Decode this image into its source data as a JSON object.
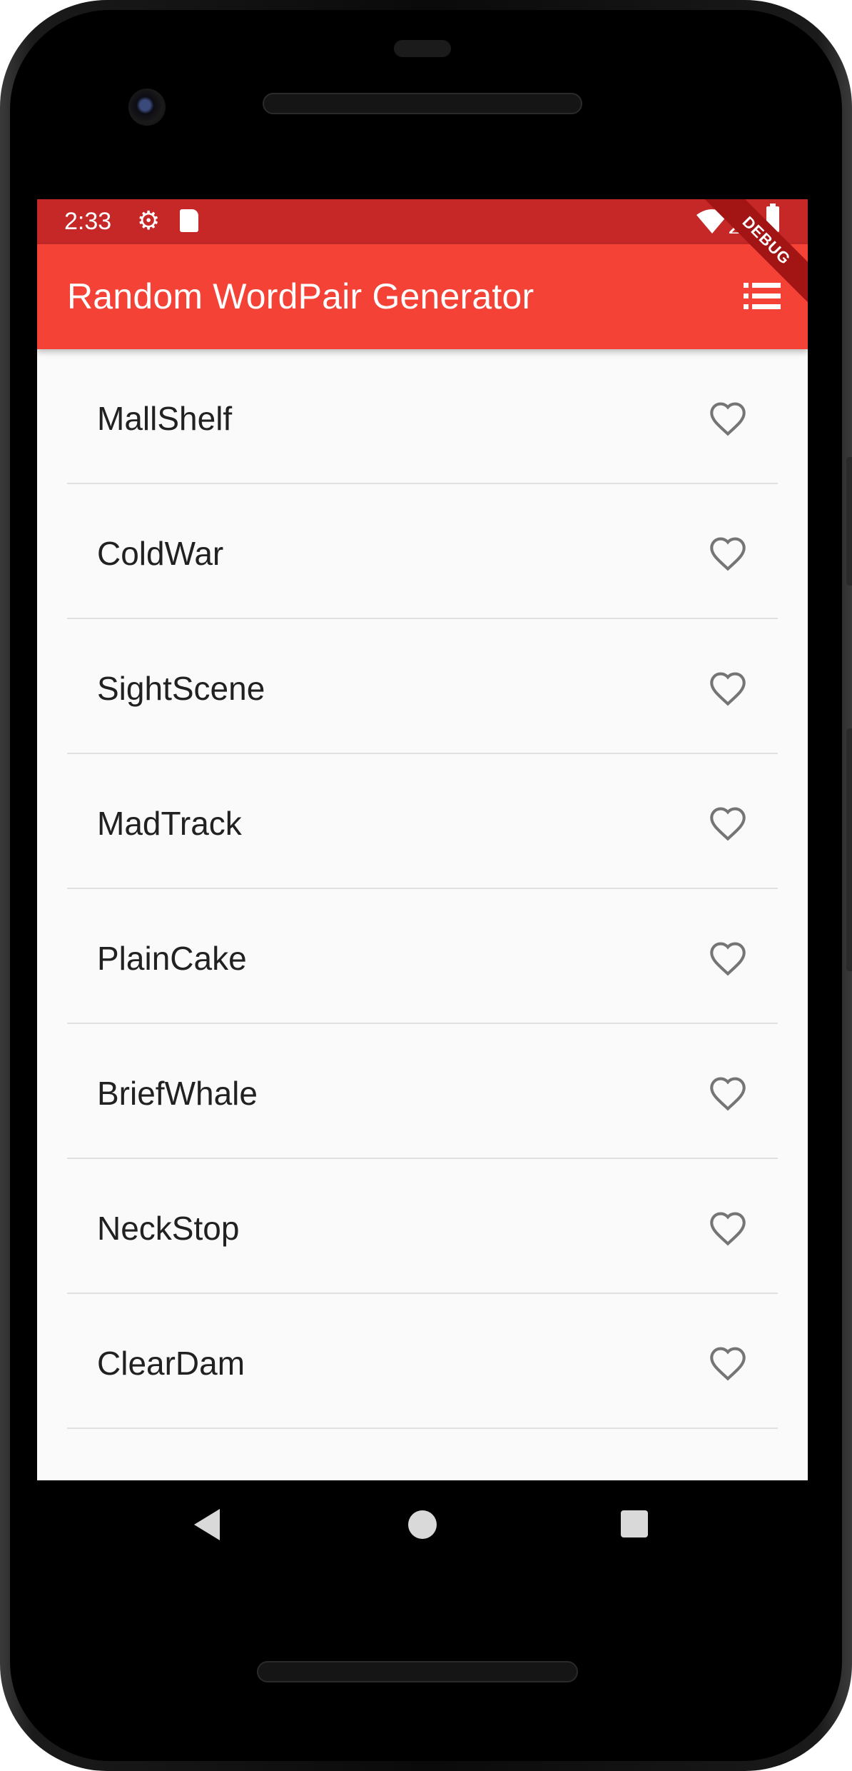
{
  "status_bar": {
    "time": "2:33",
    "icons": [
      "gear-icon",
      "sd-card-icon",
      "wifi-icon",
      "signal-icon",
      "battery-icon"
    ]
  },
  "app_bar": {
    "title": "Random WordPair Generator",
    "action_icon": "list-icon",
    "color": "#f44336",
    "status_color": "#c62828"
  },
  "debug_banner": "DEBUG",
  "word_pairs": [
    {
      "label": "MallShelf",
      "favorited": false
    },
    {
      "label": "ColdWar",
      "favorited": false
    },
    {
      "label": "SightScene",
      "favorited": false
    },
    {
      "label": "MadTrack",
      "favorited": false
    },
    {
      "label": "PlainCake",
      "favorited": false
    },
    {
      "label": "BriefWhale",
      "favorited": false
    },
    {
      "label": "NeckStop",
      "favorited": false
    },
    {
      "label": "ClearDam",
      "favorited": false
    }
  ],
  "nav_bar": {
    "icons": [
      "back-icon",
      "home-icon",
      "recents-icon"
    ]
  }
}
